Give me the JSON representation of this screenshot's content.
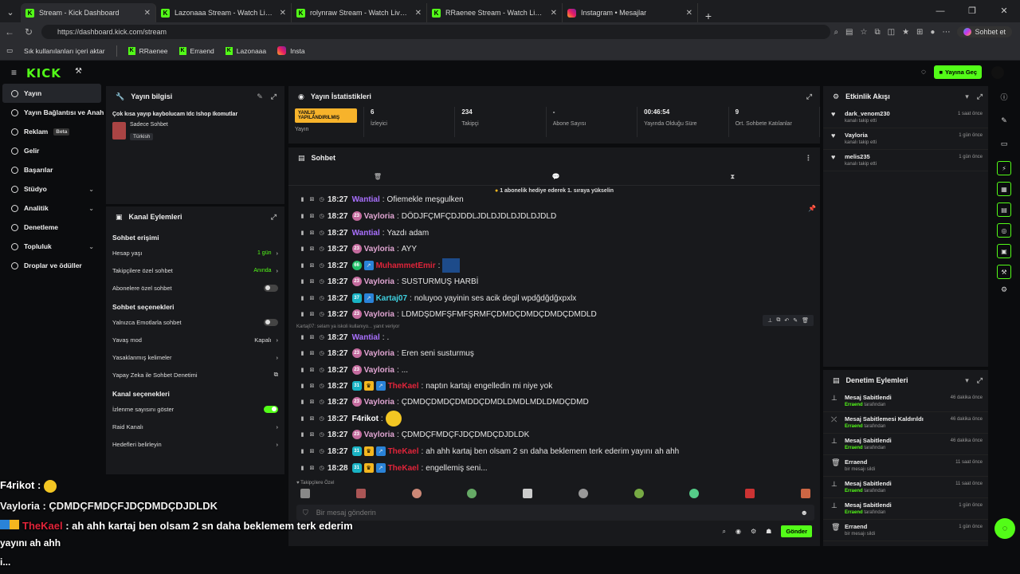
{
  "browser": {
    "tabs": [
      {
        "title": "Stream - Kick Dashboard",
        "icon": "kick-icon",
        "active": true
      },
      {
        "title": "Lazonaaa Stream - Watch Live on K",
        "icon": "kick-icon"
      },
      {
        "title": "rolynraw Stream - Watch Live on K",
        "icon": "kick-icon"
      },
      {
        "title": "RRaenee Stream - Watch Live on K",
        "icon": "kick-icon"
      },
      {
        "title": "Instagram • Mesajlar",
        "icon": "instagram-icon"
      }
    ],
    "url": "https://dashboard.kick.com/stream",
    "copilot_label": "Sohbet et",
    "bookmarks": [
      "Sık kullanılanları içeri aktar",
      "RRaenee",
      "Erraend",
      "Lazonaaa",
      "Insta"
    ]
  },
  "app": {
    "logo": "KICK",
    "go_live": "Yayına Geç"
  },
  "sidebar": {
    "items": [
      {
        "label": "Yayın",
        "active": true
      },
      {
        "label": "Yayın Bağlantısı ve Anahtarı"
      },
      {
        "label": "Reklam",
        "badge": "Beta"
      },
      {
        "label": "Gelir"
      },
      {
        "label": "Başarılar"
      },
      {
        "label": "Stüdyo",
        "chevron": true
      },
      {
        "label": "Analitik",
        "chevron": true
      },
      {
        "label": "Denetleme"
      },
      {
        "label": "Topluluk",
        "chevron": true
      },
      {
        "label": "Droplar ve ödüller"
      }
    ]
  },
  "stream_info": {
    "title": "Yayın bilgisi",
    "stream_title": "Çok kısa yayıp kaybolucam Idc Ishop Ikomutlar",
    "category": "Sadece Sohbet",
    "language": "Türkish"
  },
  "channel_actions": {
    "title": "Kanal Eylemleri",
    "chat_access_heading": "Sohbet erişimi",
    "chat_access": [
      {
        "label": "Hesap yaşı",
        "value": "1 gün"
      },
      {
        "label": "Takipçilere özel sohbet",
        "value": "Anında"
      },
      {
        "label": "Abonelere özel sohbet",
        "toggle": false
      }
    ],
    "chat_options_heading": "Sohbet seçenekleri",
    "chat_options": [
      {
        "label": "Yalnızca Emotlarla sohbet",
        "toggle": false
      },
      {
        "label": "Yavaş mod",
        "value": "Kapalı"
      },
      {
        "label": "Yasaklanmış kelimeler"
      },
      {
        "label": "Yapay Zeka ile Sohbet Denetimi"
      }
    ],
    "channel_options_heading": "Kanal seçenekleri",
    "channel_options": [
      {
        "label": "İzlenme sayısını göster",
        "toggle": true
      },
      {
        "label": "Raid Kanalı"
      },
      {
        "label": "Hedefleri belirleyin"
      }
    ]
  },
  "stats": {
    "title": "Yayın İstatistikleri",
    "warning": "YANLIŞ YAPILANDIRILMIŞ",
    "items": [
      {
        "value": "",
        "label": "Yayın"
      },
      {
        "value": "6",
        "label": "İzleyici"
      },
      {
        "value": "234",
        "label": "Takipçi"
      },
      {
        "value": "-",
        "label": "Abone Sayısı"
      },
      {
        "value": "00:46:54",
        "label": "Yayında Olduğu Süre"
      },
      {
        "value": "9",
        "label": "Ort. Sohbete Katılanlar"
      }
    ]
  },
  "chat": {
    "title": "Sohbet",
    "pinned_banner": "1 abonelik hediye ederek 1. sıraya yükselin",
    "reply_note": "Kartaj07: selam ya iskoli kullanıyo... yanıt veriyor",
    "placeholder": "Bir mesaj gönderin",
    "followers_label": "Takipçilere Özel",
    "send": "Gönder",
    "messages": [
      {
        "time": "18:27",
        "user": "Wantial",
        "color": "#a970ff",
        "text": "Ofiemekle meşgulken"
      },
      {
        "time": "18:27",
        "user": "Vayloria",
        "color": "#e0a5d2",
        "badge": "23",
        "text": "DÖDJFÇMFÇDJDDLJDLDJDLDJDLDJDLD"
      },
      {
        "time": "18:27",
        "user": "Wantial",
        "color": "#a970ff",
        "text": "Yazdı adam"
      },
      {
        "time": "18:27",
        "user": "Vayloria",
        "color": "#e0a5d2",
        "badge": "23",
        "text": "AYY"
      },
      {
        "time": "18:27",
        "user": "MuhammetEmir",
        "color": "#e0243a",
        "badge": "66",
        "text": ""
      },
      {
        "time": "18:27",
        "user": "Vayloria",
        "color": "#e0a5d2",
        "badge": "23",
        "text": "SUSTURMUŞ HARBİ"
      },
      {
        "time": "18:27",
        "user": "Kartaj07",
        "color": "#3ed0e0",
        "badge": "37",
        "text": "noluyoo yayinin ses acik degil wpdğdğdğxpxlx"
      },
      {
        "time": "18:27",
        "user": "Vayloria",
        "color": "#e0a5d2",
        "badge": "23",
        "text": "LDMDŞDMFŞFMFŞRMFÇDMDÇDMDÇDMDÇDMDLD"
      },
      {
        "time": "18:27",
        "user": "Wantial",
        "color": "#a970ff",
        "text": "."
      },
      {
        "time": "18:27",
        "user": "Vayloria",
        "color": "#e0a5d2",
        "badge": "23",
        "text": "Eren seni susturmuş"
      },
      {
        "time": "18:27",
        "user": "Vayloria",
        "color": "#e0a5d2",
        "badge": "23",
        "text": "..."
      },
      {
        "time": "18:27",
        "user": "TheKael",
        "color": "#e0243a",
        "badge": "31",
        "text": "naptın kartajı engelledin mi niye yok"
      },
      {
        "time": "18:27",
        "user": "Vayloria",
        "color": "#e0a5d2",
        "badge": "23",
        "text": "ÇDMDÇDMDÇDMDDÇDMDLDMDLMDLDMDÇDMD"
      },
      {
        "time": "18:27",
        "user": "F4rikot",
        "color": "#ffffff",
        "text": ""
      },
      {
        "time": "18:27",
        "user": "Vayloria",
        "color": "#e0a5d2",
        "badge": "23",
        "text": "ÇDMDÇFMDÇFJDÇDMDÇDJDLDK"
      },
      {
        "time": "18:27",
        "user": "TheKael",
        "color": "#e0243a",
        "badge": "31",
        "text": "ah ahh kartaj ben olsam 2 sn daha beklemem terk ederim yayını ah ahh"
      },
      {
        "time": "18:28",
        "user": "TheKael",
        "color": "#e0243a",
        "badge": "31",
        "text": "engellemiş seni..."
      }
    ]
  },
  "activity": {
    "title": "Etkinlik Akışı",
    "items": [
      {
        "name": "dark_venom230",
        "sub": "kanalı takip etti",
        "time": "1 saat önce"
      },
      {
        "name": "Vayloria",
        "sub": "kanalı takip etti",
        "time": "1 gün önce"
      },
      {
        "name": "melis235",
        "sub": "kanalı takip etti",
        "time": "1 gün önce"
      }
    ]
  },
  "moderation": {
    "title": "Denetim Eylemleri",
    "items": [
      {
        "name": "Mesaj Sabitlendi",
        "who": "Erraend",
        "sub": "tarafından",
        "time": "46 dakika önce",
        "icon": "pin-icon"
      },
      {
        "name": "Mesaj Sabitlemesi Kaldırıldı",
        "who": "Erraend",
        "sub": "tarafından",
        "time": "46 dakika önce",
        "icon": "unpin-icon"
      },
      {
        "name": "Mesaj Sabitlendi",
        "who": "Erraend",
        "sub": "tarafından",
        "time": "46 dakika önce",
        "icon": "pin-icon"
      },
      {
        "name": "Erraend",
        "who": "",
        "sub": "bir mesajı sildi",
        "time": "11 saat önce",
        "icon": "trash-icon"
      },
      {
        "name": "Mesaj Sabitlendi",
        "who": "Erraend",
        "sub": "tarafından",
        "time": "11 saat önce",
        "icon": "pin-icon"
      },
      {
        "name": "Mesaj Sabitlendi",
        "who": "Erraend",
        "sub": "tarafından",
        "time": "1 gün önce",
        "icon": "pin-icon"
      },
      {
        "name": "Erraend",
        "who": "",
        "sub": "bir mesajı sildi",
        "time": "1 gün önce",
        "icon": "trash-icon"
      }
    ]
  },
  "overlay": {
    "line1_user": "F4rikot :",
    "line2": "Vayloria : ÇDMDÇFMDÇFJDÇDMDÇDJDLDK",
    "line3_user": "TheKael",
    "line3_text": ": ah ahh kartaj ben olsam 2 sn daha beklemem terk ederim",
    "line4": "yayını ah ahh",
    "line5": "i..."
  }
}
